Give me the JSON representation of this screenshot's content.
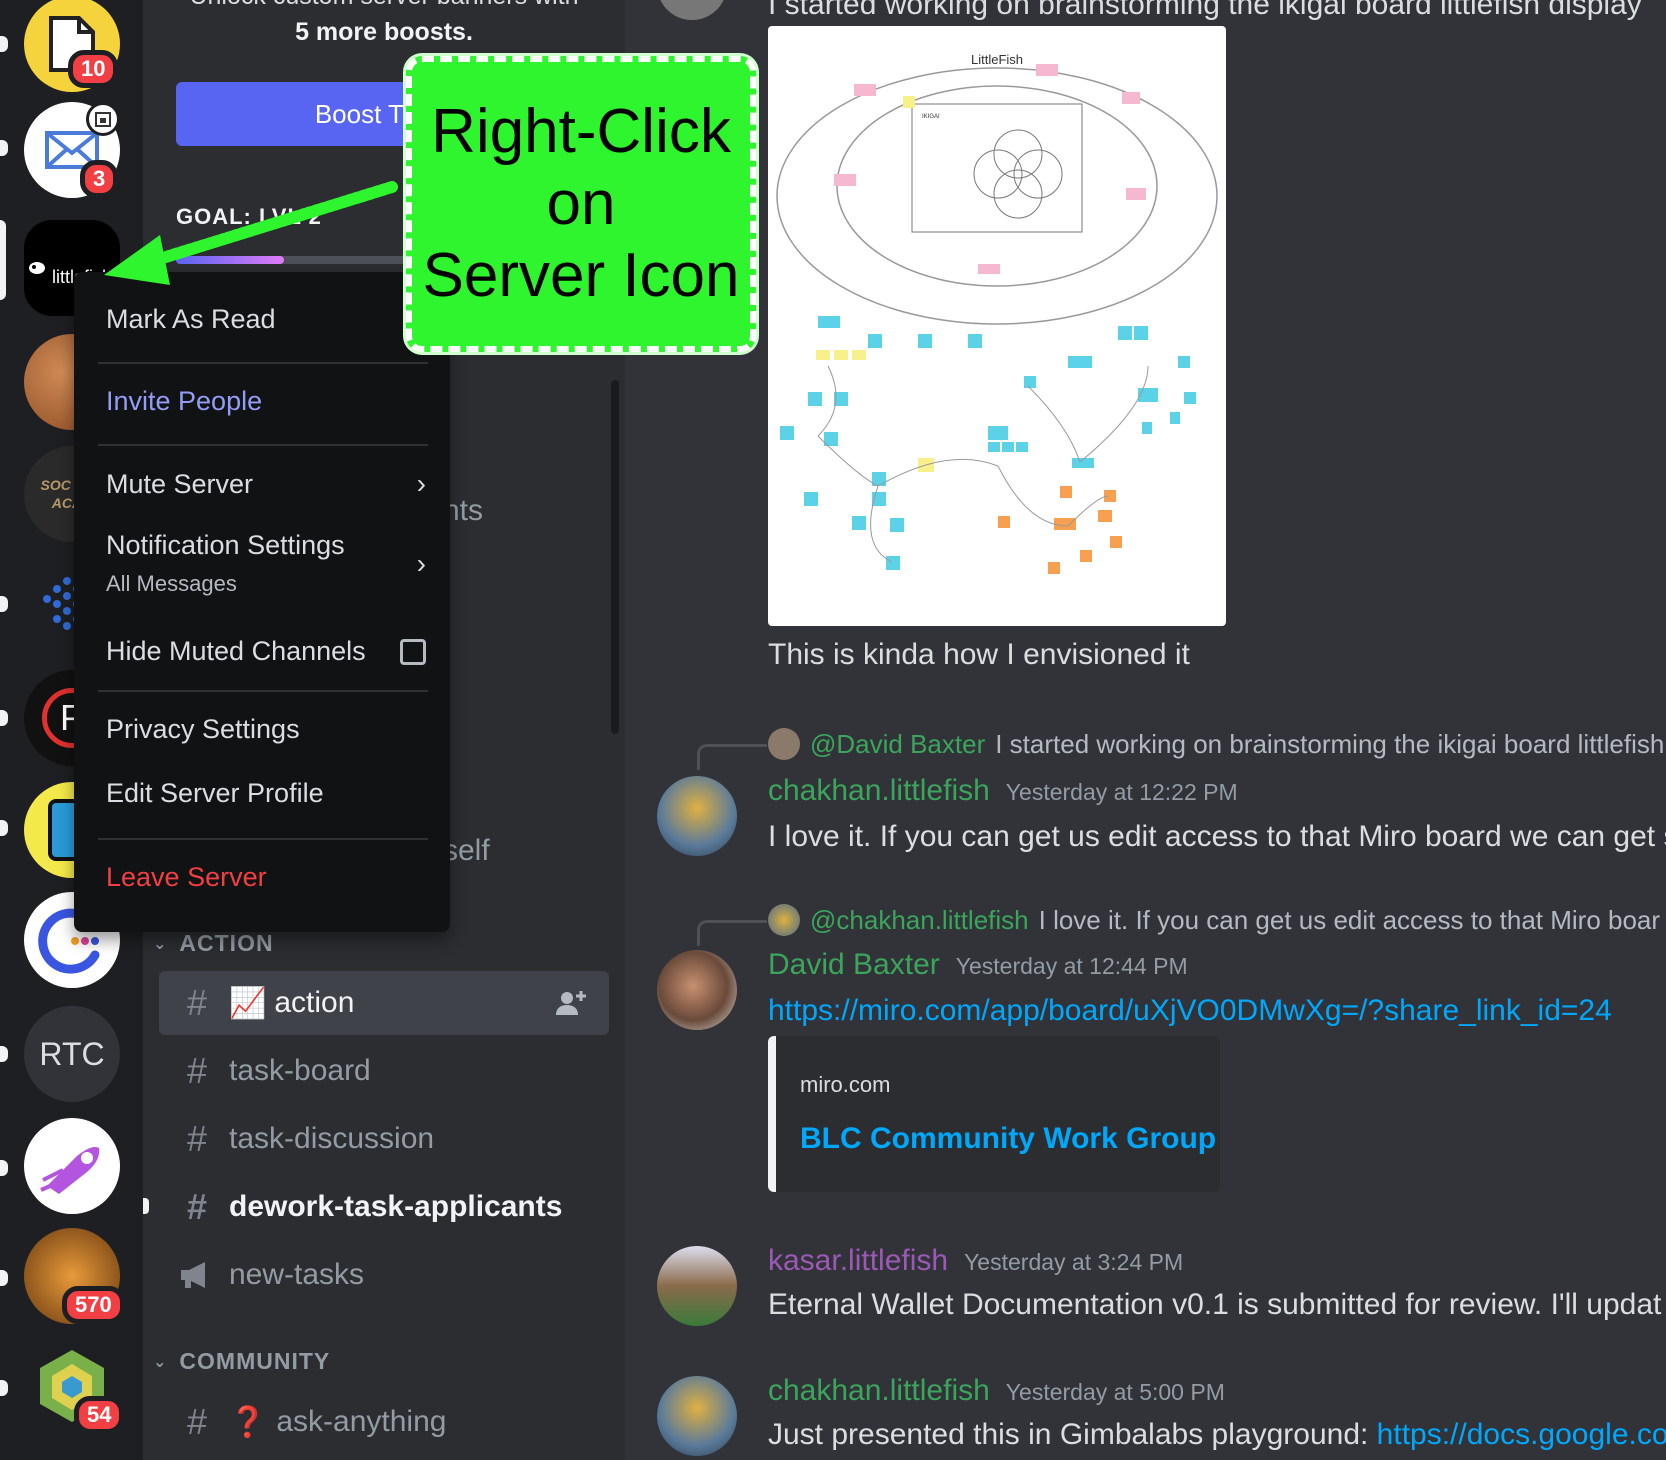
{
  "rail": {
    "servers": [
      {
        "name": "notes-server",
        "badge": "10"
      },
      {
        "name": "mail-server",
        "badge": "3"
      },
      {
        "name": "littlefish-server",
        "label": "littlefish"
      },
      {
        "name": "penny-server"
      },
      {
        "name": "social-design-academy",
        "label": "SOC DES ACAD"
      },
      {
        "name": "network-server"
      },
      {
        "name": "p-server"
      },
      {
        "name": "pixel-server"
      },
      {
        "name": "cursor-server"
      },
      {
        "name": "rtc-server",
        "label": "RTC"
      },
      {
        "name": "rocket-server"
      },
      {
        "name": "tiger-server",
        "badge": "570"
      },
      {
        "name": "hex-server",
        "badge": "54"
      }
    ]
  },
  "sidebar": {
    "boost_line1": "Unlock custom server banners with",
    "boost_line2": "5 more boosts.",
    "boost_button": "Boost This",
    "goal_label": "GOAL: LVL 2",
    "goal_progress": 0.27,
    "ghost_text_1": "nts",
    "ghost_text_2": "rself",
    "categories": {
      "action": "ACTION",
      "community": "COMMUNITY"
    },
    "channels": [
      {
        "label": "action",
        "emoji": "📈"
      },
      {
        "label": "task-board"
      },
      {
        "label": "task-discussion"
      },
      {
        "label": "dework-task-applicants"
      },
      {
        "label": "new-tasks"
      },
      {
        "label": "ask-anything",
        "emoji": "❓"
      }
    ]
  },
  "context_menu": {
    "mark_as_read": "Mark As Read",
    "invite_people": "Invite People",
    "mute_server": "Mute Server",
    "notification_settings": "Notification Settings",
    "notification_value": "All Messages",
    "hide_muted": "Hide Muted Channels",
    "privacy_settings": "Privacy Settings",
    "edit_server_profile": "Edit Server Profile",
    "leave_server": "Leave Server"
  },
  "annotation": {
    "line1": "Right-Click",
    "line2": "on",
    "line3": "Server Icon"
  },
  "chat": {
    "top_text": "I started working on brainstorming the ikigai board littlefish display",
    "image_title": "LittleFish",
    "image_box_title": "IKIGAI",
    "caption": "This is kinda how I envisioned it",
    "messages": [
      {
        "reply_to": "@David Baxter",
        "reply_text": "I started working on brainstorming the ikigai board littlefish",
        "author": "chakhan.littlefish",
        "author_color": "#3ba55c",
        "time": "Yesterday at 12:22 PM",
        "text": "I love it. If you can get us edit access to that Miro board we can get s"
      },
      {
        "reply_to": "@chakhan.littlefish",
        "reply_text": "I love it. If you can get us edit access to that Miro boar",
        "author": "David Baxter",
        "author_color": "#3ba55c",
        "time": "Yesterday at 12:44 PM",
        "link": "https://miro.com/app/board/uXjVO0DMwXg=/?share_link_id=24",
        "embed_site": "miro.com",
        "embed_title": "BLC Community Work Group"
      },
      {
        "author": "kasar.littlefish",
        "author_color": "#9b59b6",
        "time": "Yesterday at 3:24 PM",
        "text": "Eternal Wallet Documentation v0.1 is submitted for review. I'll updat"
      },
      {
        "author": "chakhan.littlefish",
        "author_color": "#3ba55c",
        "time": "Yesterday at 5:00 PM",
        "text": "Just presented this in Gimbalabs playground: ",
        "link": "https://docs.google.co"
      }
    ]
  }
}
